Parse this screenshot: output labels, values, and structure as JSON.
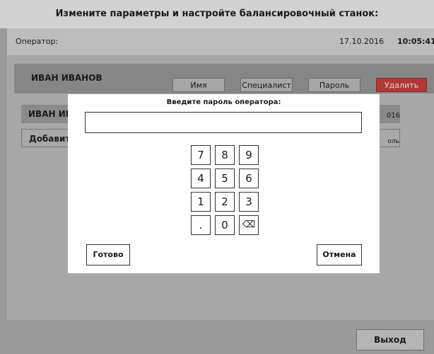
{
  "window": {
    "title": "Измените параметры и настройте балансировочный станок:"
  },
  "info": {
    "operator_label": "Оператор:",
    "date": "17.10.2016",
    "time": "10:05:41"
  },
  "user_header": {
    "name": "ИВАН ИВАНОВ",
    "buttons": {
      "name": "Имя",
      "specialist": "Специалист",
      "password": "Пароль",
      "delete": "Удалить"
    }
  },
  "list": {
    "user_item": "ИВАН ИВ",
    "add_item": "Добавить",
    "right_fragment_1": "016",
    "right_fragment_2": "оль"
  },
  "footer": {
    "exit": "Выход"
  },
  "modal": {
    "title": "Введите пароль оператора:",
    "password_value": "",
    "keys": [
      "7",
      "8",
      "9",
      "4",
      "5",
      "6",
      "1",
      "2",
      "3",
      ".",
      "0",
      "⌫"
    ],
    "ok": "Готово",
    "cancel": "Отмена"
  },
  "colors": {
    "delete_button": "#b23838",
    "modal_bg": "#ffffff",
    "dim_bg": "#9a9a9a"
  }
}
